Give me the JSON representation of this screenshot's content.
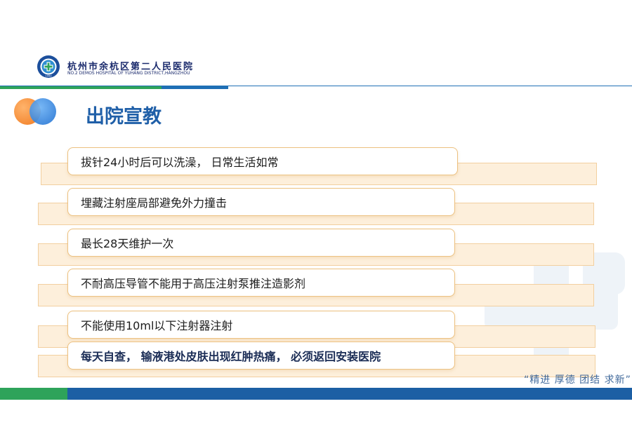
{
  "header": {
    "hospital_name_cn": "杭州市余杭区第二人民医院",
    "hospital_name_en": "NO.2 DEMOS  HOSPITAL OF YUHANG DISTRICT,HANGZHOU",
    "logo_icon": "hospital-emblem-icon",
    "logo_year": "1943"
  },
  "title": "出院宣教",
  "items": [
    "拔针24小时后可以洗澡，  日常生活如常",
    "埋藏注射座局部避免外力撞击",
    "最长28天维护一次",
    "不耐高压导管不能用于高压注射泵推注造影剂",
    "不能使用10ml以下注射器注射",
    "每天自查， 输液港处皮肤出现红肿热痛， 必须返回安装医院"
  ],
  "slogan": "“精进 厚德 团结 求新”",
  "colors": {
    "brand_blue": "#1f5fa8",
    "brand_green": "#2ea35a",
    "box_border": "#ecc181",
    "band_fill": "#fdefdb"
  }
}
